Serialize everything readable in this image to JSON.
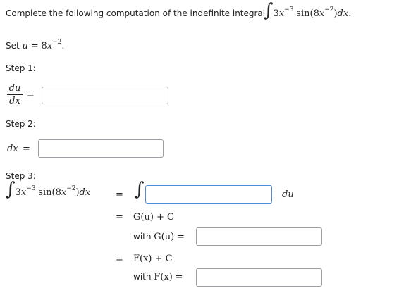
{
  "problem": {
    "prompt": "Complete the following computation of the indefinite integral",
    "integrand": {
      "coef": "3",
      "var": "x",
      "exp1": "−3",
      "fn": "sin",
      "inner_coef": "8",
      "inner_exp": "−2",
      "diff": "dx"
    }
  },
  "setup": {
    "label": "Set",
    "var": "u",
    "eq": "=",
    "rhs_coef": "8",
    "rhs_var": "x",
    "rhs_exp": "−2",
    "period": "."
  },
  "step1": {
    "label": "Step 1:",
    "num": "du",
    "den": "dx",
    "eq": "=",
    "answer": ""
  },
  "step2": {
    "label": "Step 2:",
    "lhs": "dx",
    "eq": "=",
    "answer": ""
  },
  "step3": {
    "label": "Step 3:",
    "eq": "=",
    "integrand_answer": "",
    "du_label": "du",
    "line_g": "G(u) + C",
    "with_g_label": "with",
    "with_g_fn": "G(u)",
    "g_answer": "",
    "line_f": "F(x) + C",
    "with_f_label": "with",
    "with_f_fn": "F(x)",
    "f_answer": ""
  }
}
